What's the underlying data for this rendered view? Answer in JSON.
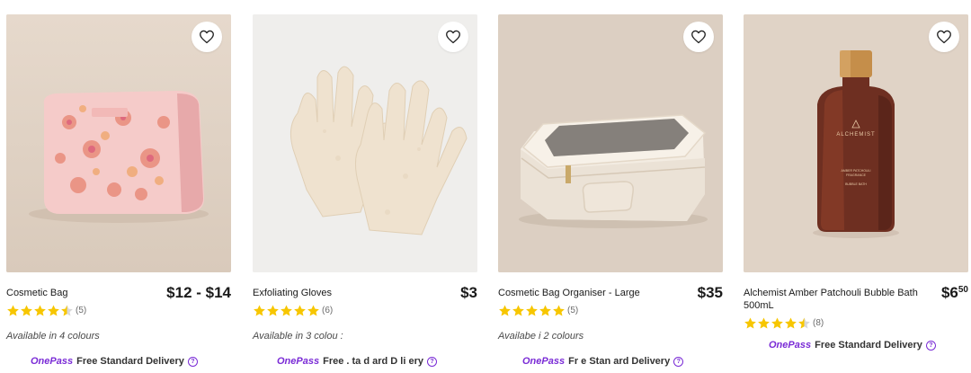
{
  "products": [
    {
      "title": "Cosmetic Bag",
      "price": "$12 - $14",
      "rating_count": "(5)",
      "rating": 4.5,
      "colours": "Available in 4 colours",
      "onepass": "OnePass",
      "delivery": "Free Standard Delivery",
      "image_bg": "#e2d5c8"
    },
    {
      "title": "Exfoliating Gloves",
      "price": "$3",
      "rating_count": "(6)",
      "rating": 5,
      "colours": "Available in 3 colou :",
      "onepass": "OnePass",
      "delivery": "Free . ta d ard D li ery",
      "image_bg": "#eeeceb"
    },
    {
      "title": "Cosmetic Bag Organiser - Large",
      "price": "$35",
      "rating_count": "(5)",
      "rating": 5,
      "colours": "Availabe i 2 colours",
      "onepass": "OnePass",
      "delivery": "Fr e Stan ard Delivery",
      "image_bg": "#dccfc2"
    },
    {
      "title": "Alchemist Amber Patchouli Bubble Bath 500mL",
      "price_dollars": "$6",
      "price_cents": "50",
      "rating_count": "(8)",
      "rating": 4.5,
      "colours": "",
      "onepass": "OnePass",
      "delivery": "Free Standard Delivery",
      "image_bg": "#e0d3c6"
    }
  ],
  "icons": {
    "favourite": "heart-outline-icon",
    "star": "star-icon",
    "help": "question-circle-icon"
  },
  "colors": {
    "star": "#f7c600",
    "onepass": "#7a2bd6"
  }
}
